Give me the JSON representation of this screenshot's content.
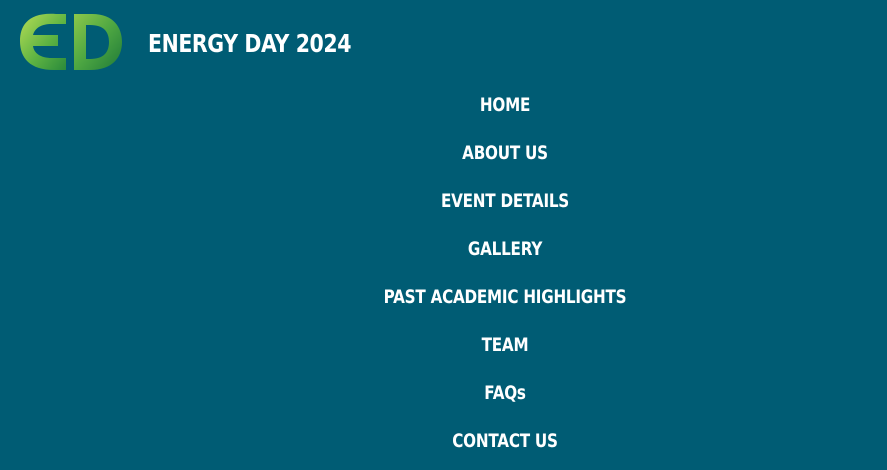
{
  "header": {
    "logo_icon": "energy-day-ed-logo",
    "logo_text": "ED",
    "title": "ENERGY DAY 2024"
  },
  "nav": {
    "items": [
      {
        "label": "HOME"
      },
      {
        "label": "ABOUT US"
      },
      {
        "label": "EVENT DETAILS"
      },
      {
        "label": "GALLERY"
      },
      {
        "label": "PAST ACADEMIC HIGHLIGHTS"
      },
      {
        "label": "TEAM"
      },
      {
        "label": "FAQs"
      },
      {
        "label": "CONTACT US"
      }
    ]
  },
  "colors": {
    "background": "#005c74",
    "text": "#ffffff",
    "logo_green_light": "#9ed24a",
    "logo_green_dark": "#2e8f3a"
  }
}
